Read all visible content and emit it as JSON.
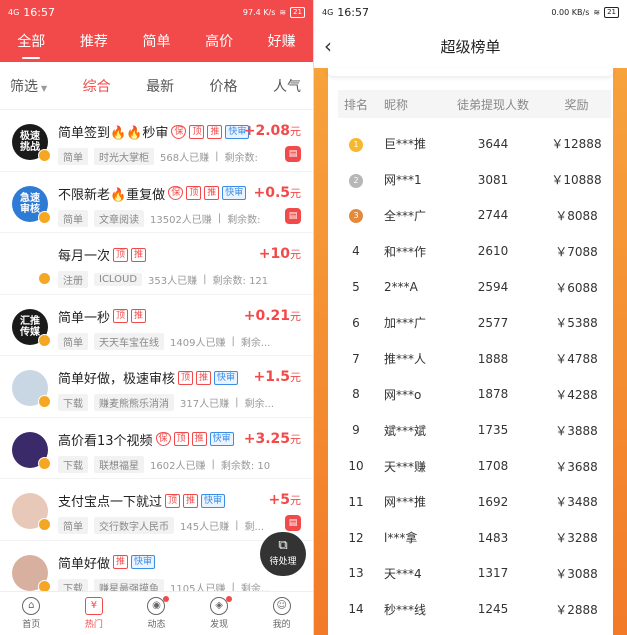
{
  "left": {
    "status": {
      "time": "16:57",
      "net": "4G",
      "right": "97.4 K/s",
      "battery": "21"
    },
    "tabs": [
      "全部",
      "推荐",
      "简单",
      "高价",
      "好赚"
    ],
    "filters": {
      "first": "筛选",
      "items": [
        "综合",
        "最新",
        "价格",
        "人气"
      ]
    },
    "items": [
      {
        "avatar": "极速\n挑战",
        "avatar_color": "#1a1a1a",
        "title": "简单签到🔥🔥秒审",
        "tags": [
          "保",
          "顶",
          "推",
          "快审"
        ],
        "price": "+2.08",
        "unit": "元",
        "chip1": "简单",
        "chip2": "时光大掌柜",
        "count": "568人已赚",
        "remain": "剩余数:"
      },
      {
        "avatar": "急速\n审核",
        "avatar_color": "#2e7bd6",
        "title": "不限新老🔥重复做",
        "tags": [
          "保",
          "顶",
          "推",
          "快审"
        ],
        "price": "+0.5",
        "unit": "元",
        "chip1": "简单",
        "chip2": "文章阅读",
        "count": "13502人已赚",
        "remain": "剩余数:"
      },
      {
        "avatar": "",
        "avatar_color": "#ffffff",
        "title": "每月一次",
        "tags": [
          "顶",
          "推"
        ],
        "price": "+10",
        "unit": "元",
        "chip1": "注册",
        "chip2": "ICLOUD",
        "count": "353人已赚",
        "remain": "剩余数: 121"
      },
      {
        "avatar": "汇推\n传媒",
        "avatar_color": "#1a1a1a",
        "title": "简单一秒",
        "tags": [
          "顶",
          "推"
        ],
        "price": "+0.21",
        "unit": "元",
        "chip1": "简单",
        "chip2": "天天车宝在线",
        "count": "1409人已赚",
        "remain": "剩余..."
      },
      {
        "avatar": "",
        "avatar_color": "#c9d6e3",
        "title": "简单好做，极速审核",
        "tags": [
          "顶",
          "推",
          "快审"
        ],
        "price": "+1.5",
        "unit": "元",
        "chip1": "下载",
        "chip2": "赚麦熊熊乐消消",
        "count": "317人已赚",
        "remain": "剩余..."
      },
      {
        "avatar": "",
        "avatar_color": "#3a2a6a",
        "title": "高价看13个视频",
        "tags": [
          "保",
          "顶",
          "推",
          "快审"
        ],
        "price": "+3.25",
        "unit": "元",
        "chip1": "下载",
        "chip2": "联想福星",
        "count": "1602人已赚",
        "remain": "剩余数: 10"
      },
      {
        "avatar": "",
        "avatar_color": "#e8c8b8",
        "title": "支付宝点一下就过",
        "tags": [
          "顶",
          "推",
          "快审"
        ],
        "price": "+5",
        "unit": "元",
        "chip1": "简单",
        "chip2": "交行数字人民币",
        "count": "145人已赚",
        "remain": "剩..."
      },
      {
        "avatar": "",
        "avatar_color": "#d8b0a0",
        "title": "简单好做",
        "tags": [
          "推",
          "快审"
        ],
        "price": "",
        "unit": "",
        "chip1": "下载",
        "chip2": "赚星最强摸鱼",
        "count": "1105人已赚",
        "remain": "剩余..."
      }
    ],
    "float_button": "待处理",
    "bottom_nav": [
      "首页",
      "热门",
      "动态",
      "发现",
      "我的"
    ]
  },
  "right": {
    "status": {
      "time": "16:57",
      "right": "0.00 KB/s",
      "battery": "21"
    },
    "title": "超级榜单",
    "headers": [
      "排名",
      "昵称",
      "徒弟提现人数",
      "奖励"
    ],
    "rows": [
      {
        "rank": "1",
        "name": "巨***推",
        "count": "3644",
        "reward": "￥12888"
      },
      {
        "rank": "2",
        "name": "网***1",
        "count": "3081",
        "reward": "￥10888"
      },
      {
        "rank": "3",
        "name": "全***广",
        "count": "2744",
        "reward": "￥8088"
      },
      {
        "rank": "4",
        "name": "和***作",
        "count": "2610",
        "reward": "￥7088"
      },
      {
        "rank": "5",
        "name": "2***A",
        "count": "2594",
        "reward": "￥6088"
      },
      {
        "rank": "6",
        "name": "加***广",
        "count": "2577",
        "reward": "￥5388"
      },
      {
        "rank": "7",
        "name": "推***人",
        "count": "1888",
        "reward": "￥4788"
      },
      {
        "rank": "8",
        "name": "网***o",
        "count": "1878",
        "reward": "￥4288"
      },
      {
        "rank": "9",
        "name": "斌***斌",
        "count": "1735",
        "reward": "￥3888"
      },
      {
        "rank": "10",
        "name": "天***赚",
        "count": "1708",
        "reward": "￥3688"
      },
      {
        "rank": "11",
        "name": "网***推",
        "count": "1692",
        "reward": "￥3488"
      },
      {
        "rank": "12",
        "name": "l***拿",
        "count": "1483",
        "reward": "￥3288"
      },
      {
        "rank": "13",
        "name": "天***4",
        "count": "1317",
        "reward": "￥3088"
      },
      {
        "rank": "14",
        "name": "秒***线",
        "count": "1245",
        "reward": "￥2888"
      }
    ],
    "medal_colors": [
      "#f5b82e",
      "#b7b7b7",
      "#e38a3c"
    ]
  },
  "colors": {
    "primary": "#f24a4a",
    "quick_tag": "#3a8ee6",
    "orange": "#f7a23b"
  }
}
